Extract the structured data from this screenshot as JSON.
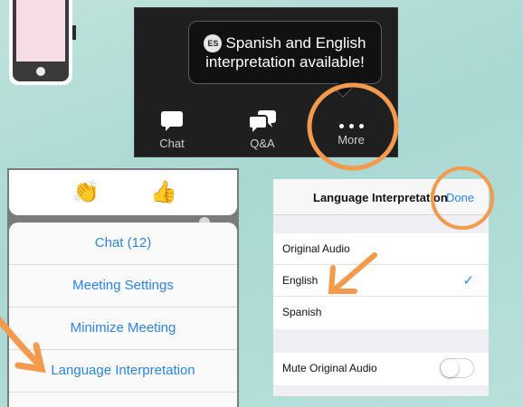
{
  "tooltip": {
    "badge": "ES",
    "line1": "Spanish and English",
    "line2": "interpretation available!"
  },
  "toolbar": {
    "chat_label": "Chat",
    "qa_label": "Q&A",
    "more_label": "More"
  },
  "reactions": {
    "clap": "👏",
    "thumbs_up": "👍"
  },
  "menu": {
    "items": [
      {
        "label": "Chat (12)"
      },
      {
        "label": "Meeting Settings"
      },
      {
        "label": "Minimize Meeting"
      },
      {
        "label": "Language Interpretation"
      }
    ]
  },
  "language_panel": {
    "title": "Language Interpretation",
    "done_label": "Done",
    "options": [
      {
        "label": "Original Audio",
        "selected": false
      },
      {
        "label": "English",
        "selected": true
      },
      {
        "label": "Spanish",
        "selected": false
      }
    ],
    "check_mark": "✓",
    "mute_label": "Mute Original Audio",
    "mute_on": false
  },
  "colors": {
    "accent_blue": "#2a84ea",
    "annotation_orange": "#f39a4c",
    "background_teal": "#b0dcd5"
  }
}
